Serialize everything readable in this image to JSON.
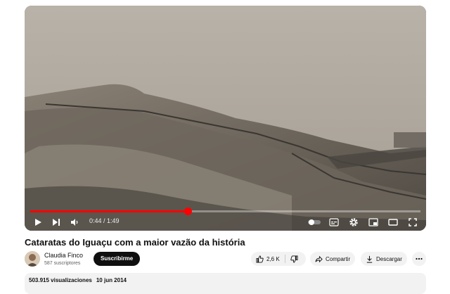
{
  "video": {
    "title": "Cataratas do Iguaçu com a maior vazão da história",
    "current_time": "0:44",
    "duration": "1:49",
    "time_separator": " / ",
    "progress": 0.404
  },
  "channel": {
    "name": "Claudia Finco",
    "subscribers": "587 suscriptores",
    "subscribe_label": "Suscribirme"
  },
  "actions": {
    "likes": "2,6 K",
    "share_label": "Compartir",
    "download_label": "Descargar"
  },
  "description": {
    "views": "503.915 visualizaciones",
    "date": "10 jun 2014"
  },
  "icons": {
    "play": "play-icon",
    "next": "next-icon",
    "volume": "volume-icon",
    "autoplay": "autoplay-toggle-icon",
    "captions": "captions-icon",
    "settings": "gear-icon",
    "miniplayer": "miniplayer-icon",
    "theater": "theater-icon",
    "fullscreen": "fullscreen-icon",
    "like": "thumbs-up-icon",
    "dislike": "thumbs-down-icon",
    "share": "share-icon",
    "download": "download-icon",
    "more": "more-icon"
  },
  "colors": {
    "progress": "#ff0000",
    "subscribe_bg": "#0f0f0f",
    "pill_bg": "#f2f2f2"
  }
}
